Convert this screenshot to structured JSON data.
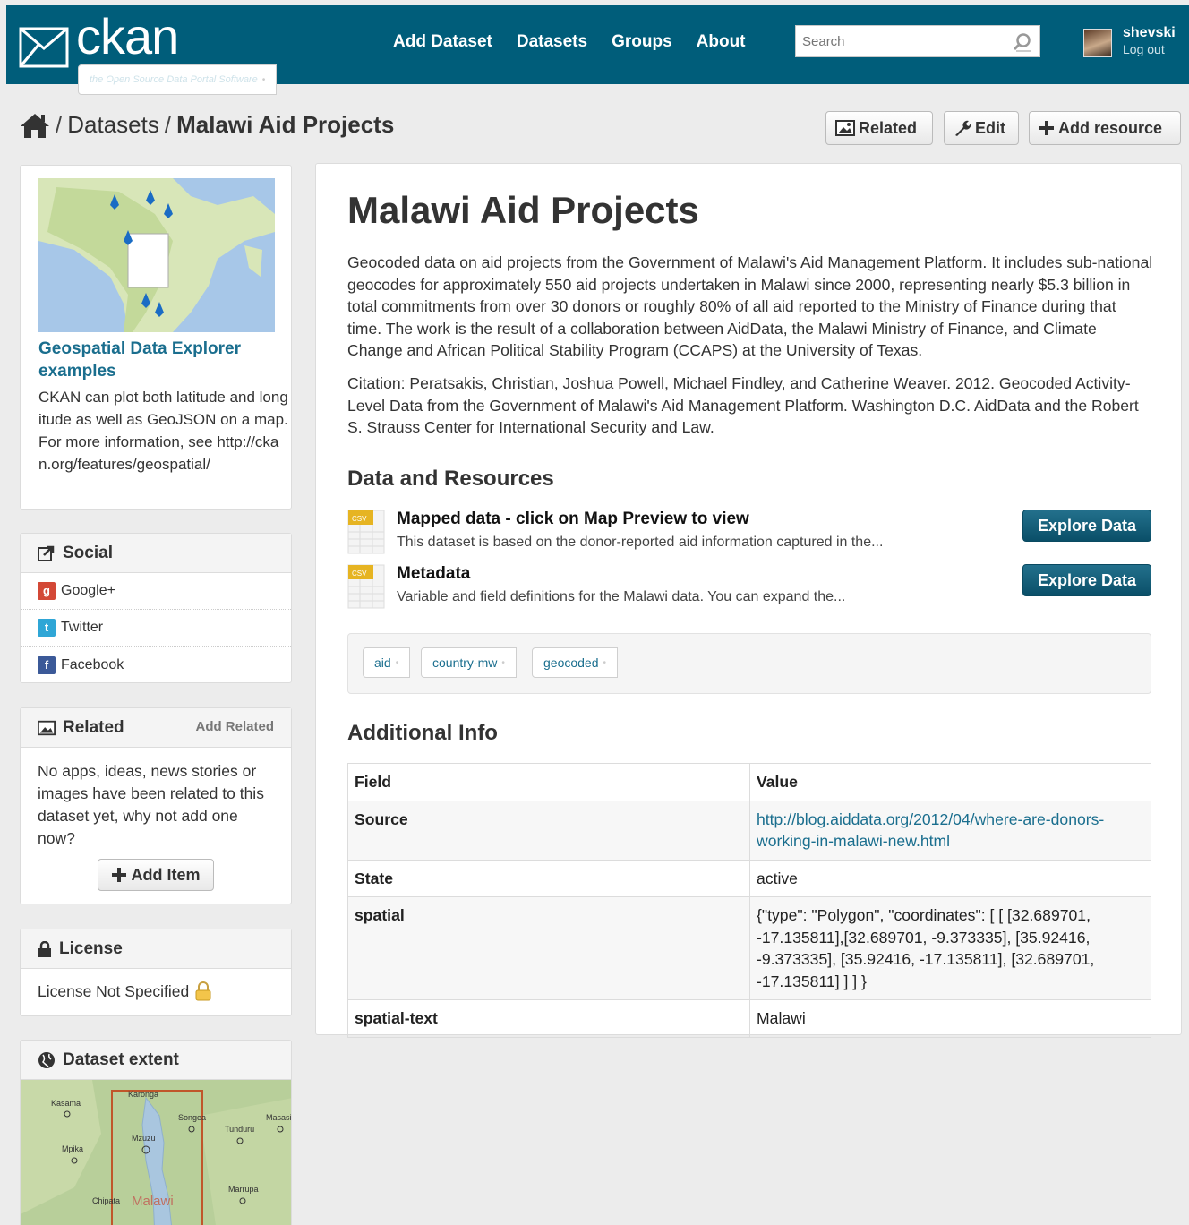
{
  "header": {
    "logo_text": "ckan",
    "logo_tagline": "the Open Source Data Portal Software",
    "nav": [
      "Add Dataset",
      "Datasets",
      "Groups",
      "About"
    ],
    "search_placeholder": "Search",
    "user_name": "shevski",
    "logout_label": "Log out",
    "brand_color": "#005d7a"
  },
  "breadcrumb": {
    "items": [
      "Datasets",
      "Malawi Aid Projects"
    ],
    "separator": "/"
  },
  "actions": {
    "related": "Related",
    "edit": "Edit",
    "add_resource": "Add resource"
  },
  "sidebar": {
    "feature": {
      "title": "Geospatial Data Explorer examples",
      "text": "CKAN can plot both latitude and longitude as well as GeoJSON on a map. For more information, see http://ckan.org/features/geospatial/"
    },
    "social": {
      "title": "Social",
      "items": [
        {
          "label": "Google+",
          "icon": "google-plus-icon",
          "color": "#d34836"
        },
        {
          "label": "Twitter",
          "icon": "twitter-icon",
          "color": "#2fa6d6"
        },
        {
          "label": "Facebook",
          "icon": "facebook-icon",
          "color": "#3b5998"
        }
      ]
    },
    "related": {
      "title": "Related",
      "add_link": "Add Related",
      "empty_text": "No apps, ideas, news stories or images have been related to this dataset yet, why not add one now?",
      "add_button": "Add Item"
    },
    "license": {
      "title": "License",
      "value": "License Not Specified"
    },
    "extent": {
      "title": "Dataset extent",
      "places": [
        "Kasama",
        "Karonga",
        "Songea",
        "Tunduru",
        "Masasi",
        "Mpika",
        "Mzuzu",
        "Marrupa",
        "Chipata",
        "Malawi"
      ]
    }
  },
  "dataset": {
    "title": "Malawi Aid Projects",
    "description": "Geocoded data on aid projects from the Government of Malawi's Aid Management Platform. It includes sub-national geocodes for approximately 550 aid projects undertaken in Malawi since 2000, representing nearly $5.3 billion in total commitments from over 30 donors or roughly 80% of all aid reported to the Ministry of Finance during that time. The work is the result of a collaboration between AidData, the Malawi Ministry of Finance, and Climate Change and African Political Stability Program (CCAPS) at the University of Texas.",
    "citation": "Citation: Peratsakis, Christian, Joshua Powell, Michael Findley, and Catherine Weaver. 2012. Geocoded Activity-Level Data from the Government of Malawi's Aid Management Platform. Washington D.C. AidData and the Robert S. Strauss Center for International Security and Law.",
    "resources_heading": "Data and Resources",
    "resources": [
      {
        "format": "CSV",
        "title": "Mapped data - click on Map Preview to view",
        "desc": "This dataset is based on the donor-reported aid information captured in the...",
        "button": "Explore Data"
      },
      {
        "format": "CSV",
        "title": "Metadata",
        "desc": "Variable and field definitions for the Malawi data. You can expand the...",
        "button": "Explore Data"
      }
    ],
    "tags": [
      "aid",
      "country-mw",
      "geocoded"
    ],
    "additional_heading": "Additional Info",
    "table": {
      "headers": [
        "Field",
        "Value"
      ],
      "rows": [
        {
          "field": "Source",
          "value": "http://blog.aiddata.org/2012/04/where-are-donors-working-in-malawi-new.html"
        },
        {
          "field": "State",
          "value": "active"
        },
        {
          "field": "spatial",
          "value": "{\"type\": \"Polygon\", \"coordinates\": [ [ [32.689701, -17.135811],[32.689701, -9.373335], [35.92416, -9.373335], [35.92416, -17.135811], [32.689701, -17.135811] ] ] }"
        },
        {
          "field": "spatial-text",
          "value": "Malawi"
        }
      ]
    }
  }
}
